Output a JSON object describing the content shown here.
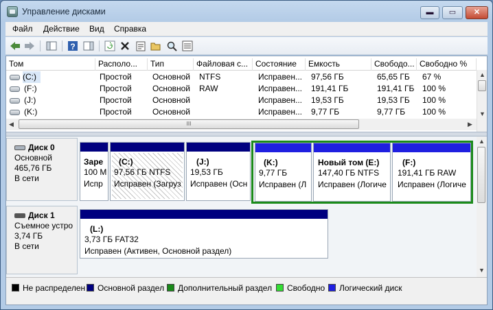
{
  "window": {
    "title": "Управление дисками",
    "min_label": "▬",
    "max_label": "▭",
    "close_label": "✕"
  },
  "menu": [
    "Файл",
    "Действие",
    "Вид",
    "Справка"
  ],
  "columns": [
    "Том",
    "Располо...",
    "Тип",
    "Файловая с...",
    "Состояние",
    "Емкость",
    "Свободо...",
    "Свободно %"
  ],
  "volumes": [
    [
      "(C:)",
      "Простой",
      "Основной",
      "NTFS",
      "Исправен...",
      "97,56 ГБ",
      "65,65 ГБ",
      "67 %"
    ],
    [
      "(F:)",
      "Простой",
      "Основной",
      "RAW",
      "Исправен...",
      "191,41 ГБ",
      "191,41 ГБ",
      "100 %"
    ],
    [
      "(J:)",
      "Простой",
      "Основной",
      "",
      "Исправен...",
      "19,53 ГБ",
      "19,53 ГБ",
      "100 %"
    ],
    [
      "(K:)",
      "Простой",
      "Основной",
      "",
      "Исправен...",
      "9,77 ГБ",
      "9,77 ГБ",
      "100 %"
    ]
  ],
  "hscroll_grip": "III",
  "disk0": {
    "name": "Диск 0",
    "type": "Основной",
    "size": "465,76 ГБ",
    "status": "В сети",
    "partitions": [
      {
        "title": "Заре",
        "line2": "100 М",
        "line3": "Испр"
      },
      {
        "title": "(C:)",
        "line2": "97,56 ГБ NTFS",
        "line3": "Исправен (Загруз"
      },
      {
        "title": "(J:)",
        "line2": "19,53 ГБ",
        "line3": "Исправен (Осн"
      },
      {
        "title": "(K:)",
        "line2": "9,77 ГБ",
        "line3": "Исправен (Л"
      },
      {
        "title": "Новый том  (E:)",
        "line2": "147,40 ГБ NTFS",
        "line3": "Исправен (Логиче"
      },
      {
        "title": "(F:)",
        "line2": "191,41 ГБ RAW",
        "line3": "Исправен (Логиче"
      }
    ]
  },
  "disk1": {
    "name": "Диск 1",
    "type": "Съемное устро",
    "size": "3,74 ГБ",
    "status": "В сети",
    "partition": {
      "title": "(L:)",
      "line2": "3,73 ГБ FAT32",
      "line3": "Исправен (Активен, Основной раздел)"
    }
  },
  "legend": [
    {
      "label": "Не распределен",
      "color": "#000000"
    },
    {
      "label": "Основной раздел",
      "color": "#00007f"
    },
    {
      "label": "Дополнительный раздел",
      "color": "#1a8a1a"
    },
    {
      "label": "Свободно",
      "color": "#33dd33"
    },
    {
      "label": "Логический диск",
      "color": "#1f1fe0"
    }
  ],
  "icons": [
    "back-icon",
    "forward-icon",
    "console-tree-icon",
    "help-icon",
    "action-pane-icon",
    "refresh-icon",
    "delete-icon",
    "properties-icon",
    "open-icon",
    "search-icon",
    "disk-list-icon"
  ]
}
